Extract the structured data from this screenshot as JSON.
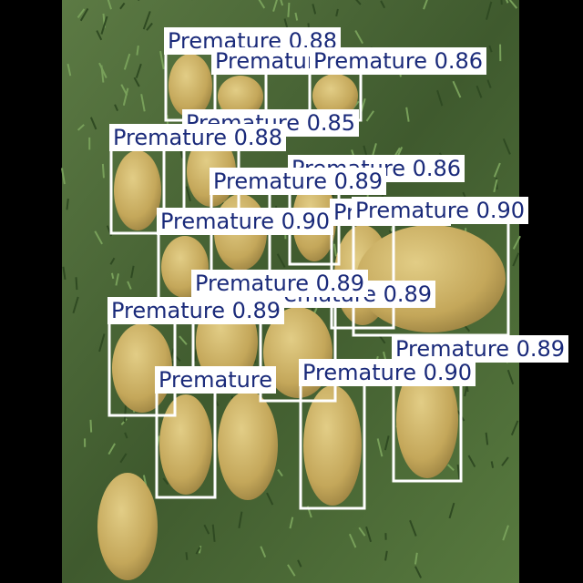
{
  "colors": {
    "box_outline": "#ffffff",
    "label_background": "#ffffff",
    "label_text": "#1a2a7a",
    "fruit_fill": "#c9b064",
    "grass_background": "#4f6b3a",
    "side_bars": "#000000"
  },
  "scene": {
    "object_kind": "coconut",
    "ground": "grass"
  },
  "detections": [
    {
      "text": "Premature 0.88",
      "class": "Premature",
      "confidence": 0.88
    },
    {
      "text": "Premature",
      "class": "Premature",
      "confidence": null
    },
    {
      "text": "Premature 0.86",
      "class": "Premature",
      "confidence": 0.86
    },
    {
      "text": "Premature 0.85",
      "class": "Premature",
      "confidence": 0.85
    },
    {
      "text": "Premature 0.88",
      "class": "Premature",
      "confidence": 0.88
    },
    {
      "text": "Premature 0.86",
      "class": "Premature",
      "confidence": 0.86
    },
    {
      "text": "Premature 0.89",
      "class": "Premature",
      "confidence": 0.89
    },
    {
      "text": "Premature 0.90",
      "class": "Premature",
      "confidence": 0.9
    },
    {
      "text": "Premature",
      "class": "Premature",
      "confidence": null
    },
    {
      "text": "Premature 0.90",
      "class": "Premature",
      "confidence": 0.9
    },
    {
      "text": "Premature 0.89",
      "class": "Premature",
      "confidence": 0.89
    },
    {
      "text": "Premature 0.89",
      "class": "Premature",
      "confidence": 0.89
    },
    {
      "text": "Premature 0.89",
      "class": "Premature",
      "confidence": 0.89
    },
    {
      "text": "Premature",
      "class": "Premature",
      "confidence": null
    },
    {
      "text": "Premature 0.89",
      "class": "Premature",
      "confidence": 0.89
    },
    {
      "text": "Premature 0.90",
      "class": "Premature",
      "confidence": 0.9
    }
  ]
}
